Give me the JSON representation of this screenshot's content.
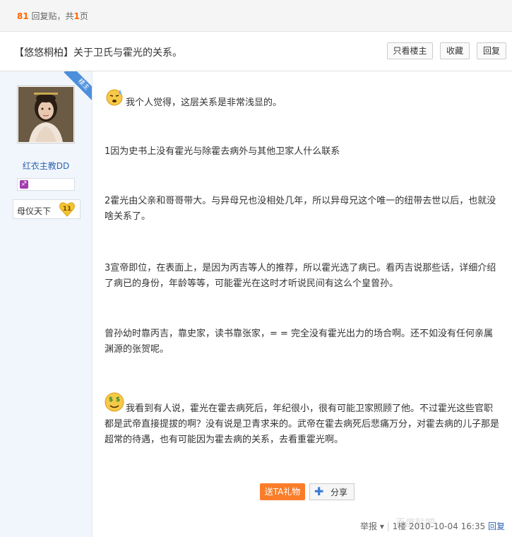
{
  "topbar": {
    "reply_count": "81",
    "reply_label": "回复贴，共",
    "page_count": "1",
    "page_label": "页"
  },
  "thread": {
    "title": "【悠悠桐柏】关于卫氏与霍光的关系。"
  },
  "buttons": {
    "only_author": "只看楼主",
    "favorite": "收藏",
    "reply": "回复"
  },
  "author": {
    "name": "红衣主教DD",
    "rank_title": "母仪天下",
    "level": "11",
    "badge": "楼主"
  },
  "post": {
    "p1": "我个人觉得，这层关系是非常浅显的。",
    "p2": "1因为史书上没有霍光与除霍去病外与其他卫家人什么联系",
    "p3": "2霍光由父亲和哥哥带大。与异母兄也没相处几年，所以异母兄这个唯一的纽带去世以后，也就没啥关系了。",
    "p4": "3宣帝即位，在表面上，是因为丙吉等人的推荐，所以霍光选了病已。看丙吉说那些话，详细介绍了病已的身份，年龄等等，可能霍光在这时才听说民间有这么个皇曾孙。",
    "p5": "曾孙幼时靠丙吉，靠史家，读书靠张家，= = 完全没有霍光出力的场合啊。还不如没有任何亲属渊源的张贺呢。",
    "p6": "我看到有人说，霍光在霍去病死后，年纪很小，很有可能卫家照顾了他。不过霍光这些官职都是武帝直接提拔的啊？没有说是卫青求来的。武帝在霍去病死后悲痛万分，对霍去病的儿子那是超常的待遇，也有可能因为霍去病的关系，去看重霍光啊。"
  },
  "actions": {
    "gift": "送TA礼物",
    "share": "分享"
  },
  "footer": {
    "report": "举报",
    "floor": "1楼",
    "date": "2010-10-04 16:35",
    "reply_link": "回复"
  },
  "watermark": "百度贴吧"
}
